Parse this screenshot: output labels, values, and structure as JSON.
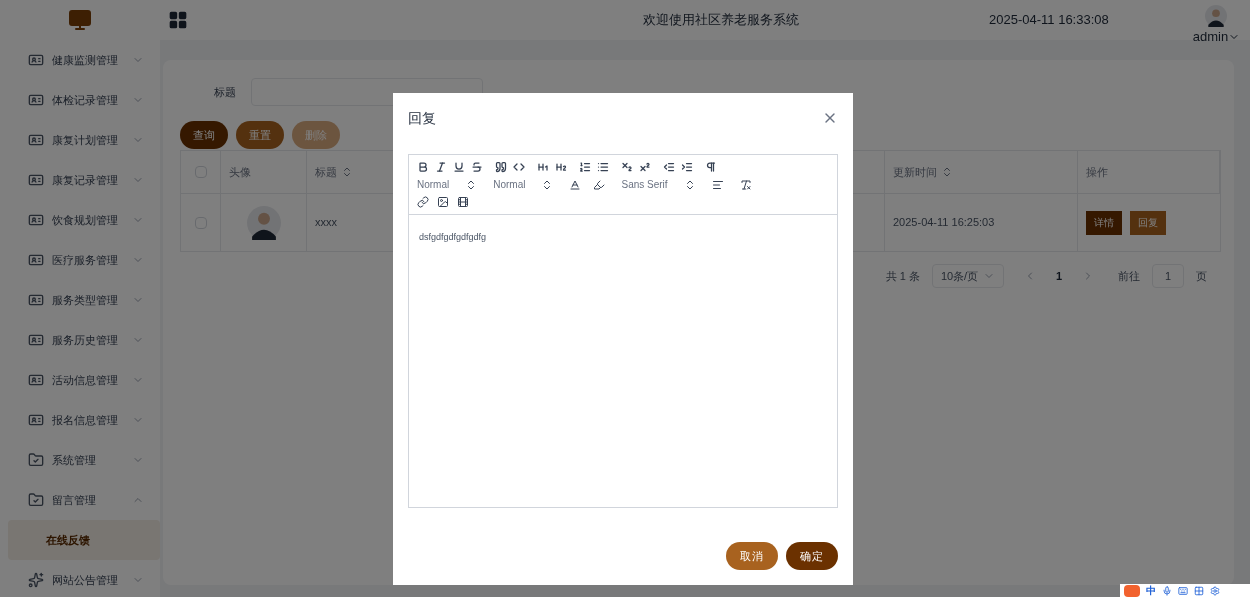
{
  "header": {
    "title": "欢迎使用社区养老服务系统",
    "datetime": "2025-04-11 16:33:08",
    "user": "admin"
  },
  "sidebar": {
    "items": [
      {
        "label": "健康监测管理",
        "kind": "module",
        "expanded": false
      },
      {
        "label": "体检记录管理",
        "kind": "module",
        "expanded": false
      },
      {
        "label": "康复计划管理",
        "kind": "module",
        "expanded": false
      },
      {
        "label": "康复记录管理",
        "kind": "module",
        "expanded": false
      },
      {
        "label": "饮食规划管理",
        "kind": "module",
        "expanded": false
      },
      {
        "label": "医疗服务管理",
        "kind": "module",
        "expanded": false
      },
      {
        "label": "服务类型管理",
        "kind": "module",
        "expanded": false
      },
      {
        "label": "服务历史管理",
        "kind": "module",
        "expanded": false
      },
      {
        "label": "活动信息管理",
        "kind": "module",
        "expanded": false
      },
      {
        "label": "报名信息管理",
        "kind": "module",
        "expanded": false
      },
      {
        "label": "系统管理",
        "kind": "folder",
        "expanded": false
      },
      {
        "label": "留言管理",
        "kind": "folder",
        "expanded": true,
        "children": [
          {
            "label": "在线反馈",
            "selected": true
          }
        ]
      },
      {
        "label": "网站公告管理",
        "kind": "spark",
        "expanded": false
      }
    ]
  },
  "search": {
    "fields": [
      {
        "label": "标题"
      }
    ],
    "buttons": [
      {
        "label": "查询",
        "kind": "primary",
        "disabled": false
      },
      {
        "label": "重置",
        "kind": "secondary",
        "disabled": false
      },
      {
        "label": "删除",
        "kind": "danger",
        "disabled": true
      }
    ]
  },
  "table": {
    "select_all_checked": false,
    "columns": [
      {
        "label": "头像",
        "sortable": false
      },
      {
        "label": "标题",
        "sortable": true
      },
      {
        "label": "更新时间",
        "sortable": true
      },
      {
        "label": "操作",
        "sortable": false
      }
    ],
    "rows": [
      {
        "checked": false,
        "title": "xxxx",
        "updated": "2025-04-11 16:25:03",
        "actions": [
          {
            "label": "详情",
            "kind": "primary"
          },
          {
            "label": "回复",
            "kind": "secondary"
          }
        ]
      }
    ]
  },
  "pagination": {
    "total": "共 1 条",
    "page_size": "10条/页",
    "pages": [
      {
        "label": "1",
        "selected": true
      }
    ],
    "goto_label": "前往",
    "goto_value": "1",
    "goto_suffix": "页"
  },
  "modal": {
    "title": "回复",
    "selects": [
      "Normal",
      "Normal",
      "Sans Serif"
    ],
    "content": "dsfgdfgdfgdfgdfg",
    "buttons": [
      {
        "label": "取消",
        "kind": "secondary"
      },
      {
        "label": "确定",
        "kind": "primary"
      }
    ]
  },
  "ime": {
    "mode": "中"
  }
}
